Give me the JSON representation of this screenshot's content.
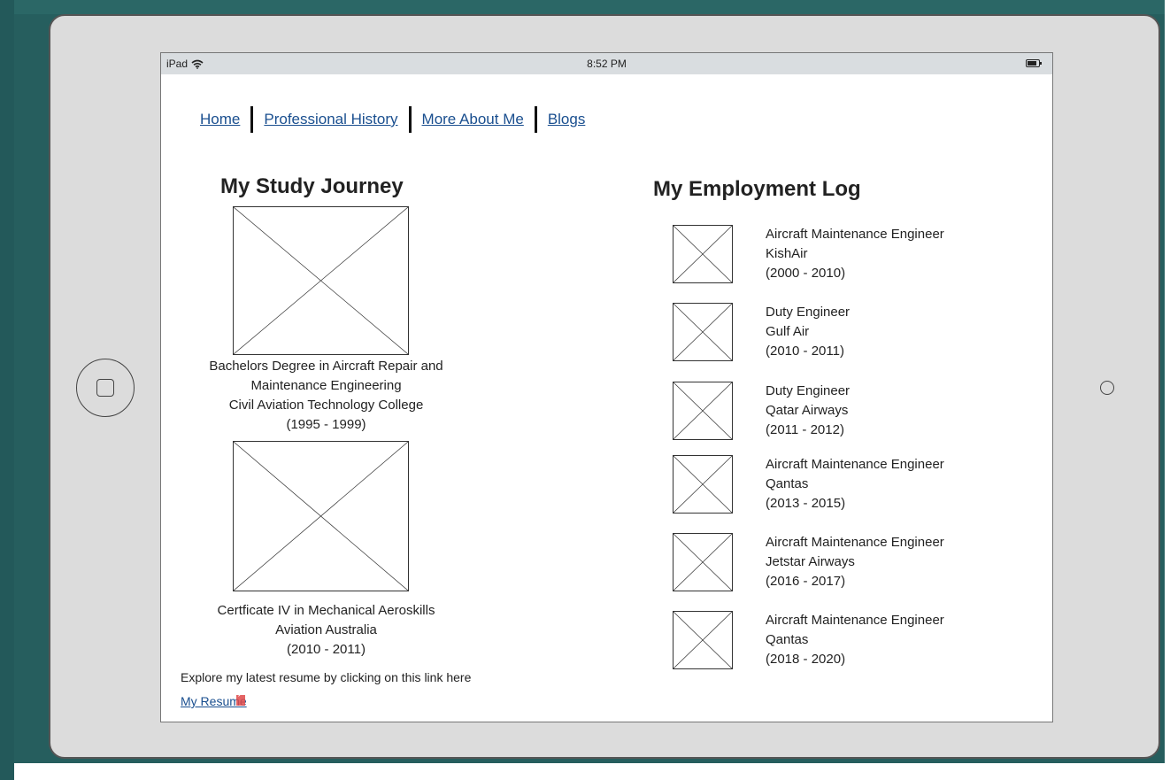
{
  "status_bar": {
    "device": "iPad",
    "time": "8:52 PM"
  },
  "nav": {
    "items": [
      {
        "label": "Home"
      },
      {
        "label": "Professional History"
      },
      {
        "label": "More About Me"
      },
      {
        "label": "Blogs"
      }
    ]
  },
  "study": {
    "title": "My Study Journey",
    "entries": [
      {
        "lines": [
          "Bachelors Degree in Aircraft Repair and",
          "Maintenance Engineering",
          "Civil Aviation Technology College",
          "(1995 - 1999)"
        ]
      },
      {
        "lines": [
          "Certficate IV in Mechanical Aeroskills",
          "Aviation Australia",
          "(2010 - 2011)"
        ]
      }
    ],
    "explore_text": "Explore my latest resume by clicking on this link here",
    "resume_link": "My Resume"
  },
  "employment": {
    "title": "My Employment Log",
    "jobs": [
      {
        "role": "Aircraft Maintenance Engineer",
        "company": "KishAir",
        "years": "(2000 - 2010)"
      },
      {
        "role": "Duty Engineer",
        "company": "Gulf Air",
        "years": "(2010 - 2011)"
      },
      {
        "role": "Duty Engineer",
        "company": "Qatar Airways",
        "years": "(2011 - 2012)"
      },
      {
        "role": "Aircraft Maintenance Engineer",
        "company": "Qantas",
        "years": "(2013 - 2015)"
      },
      {
        "role": "Aircraft Maintenance Engineer",
        "company": "Jetstar Airways",
        "years": "(2016 - 2017)"
      },
      {
        "role": "Aircraft Maintenance Engineer",
        "company": "Qantas",
        "years": "(2018 - 2020)"
      }
    ]
  },
  "icons": {
    "wifi": "wifi-icon",
    "battery": "battery-icon",
    "home_button": "home-button-icon",
    "camera": "camera-icon",
    "image_placeholder": "image-placeholder-icon",
    "external_link": "external-link-icon"
  },
  "colors": {
    "link": "#1a4f8f",
    "frame": "#dcdcdc",
    "background": "#265e5e"
  }
}
